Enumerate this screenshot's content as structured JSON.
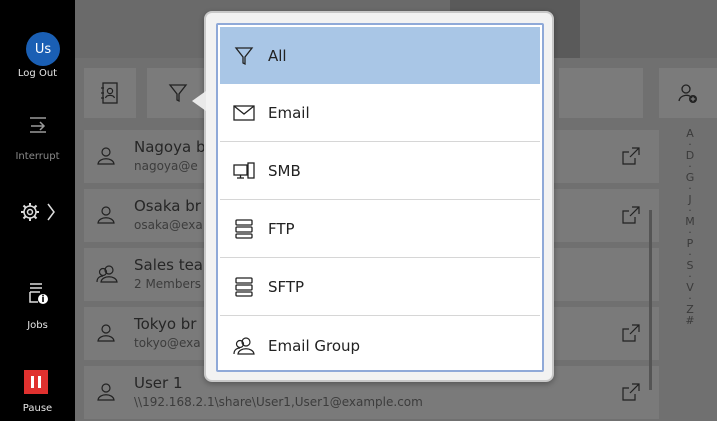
{
  "sidebar": {
    "avatar_initials": "Us",
    "logout_label": "Log Out",
    "interrupt_label": "Interrupt",
    "jobs_label": "Jobs",
    "pause_label": "Pause"
  },
  "alpha_index": [
    "A",
    "·",
    "D",
    "·",
    "G",
    "·",
    "J",
    "·",
    "M",
    "·",
    "P",
    "·",
    "S",
    "·",
    "V",
    "·",
    "Z",
    "#"
  ],
  "rows": [
    {
      "name": "Nagoya b",
      "sub": "nagoya@e",
      "icon": "person-icon",
      "external": true
    },
    {
      "name": "Osaka br",
      "sub": "osaka@exa",
      "icon": "person-icon",
      "external": true
    },
    {
      "name": "Sales tea",
      "sub": "2 Members",
      "icon": "group-icon",
      "external": false
    },
    {
      "name": "Tokyo br",
      "sub": "tokyo@exa",
      "icon": "person-icon",
      "external": true
    },
    {
      "name": "User 1",
      "sub": "\\\\192.168.2.1\\share\\User1,User1@example.com",
      "icon": "person-icon",
      "external": true
    }
  ],
  "filter_menu": {
    "selected": "All",
    "items": [
      {
        "label": "All",
        "icon": "filter-icon"
      },
      {
        "label": "Email",
        "icon": "email-icon"
      },
      {
        "label": "SMB",
        "icon": "computer-icon"
      },
      {
        "label": "FTP",
        "icon": "server-icon"
      },
      {
        "label": "SFTP",
        "icon": "server-icon"
      },
      {
        "label": "Email Group",
        "icon": "group-icon"
      }
    ]
  },
  "colors": {
    "accent": "#1a5fb4",
    "selected_item": "#a9c6e6",
    "pause": "#e0312f"
  }
}
